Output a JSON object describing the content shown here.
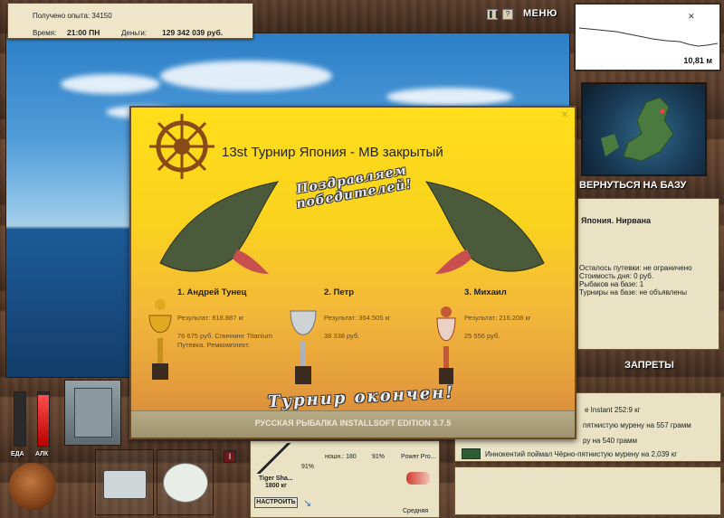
{
  "hud": {
    "experience_label": "Получено опыта:",
    "experience_value": "34150",
    "time_label": "Время:",
    "time_value": "21:00 ПН",
    "money_label": "Деньги:",
    "money_value": "129 342 039 руб.",
    "menu_label": "МЕНЮ",
    "pause_icon": "pause-icon",
    "help_icon": "help-icon"
  },
  "depth_panel": {
    "depth_value": "10,81 м"
  },
  "location": {
    "return_button": "ВЕРНУТЬСЯ НА БАЗУ",
    "name": "Япония. Нирвана",
    "info_lines": [
      "Осталось путевки: не ограничено",
      "Стоимость дня: 0 руб.",
      "Рыбаков на базе: 1",
      "Турниры на базе: не объявлены"
    ],
    "restrictions_button": "ЗАПРЕТЫ"
  },
  "catch_feed": [
    "e Instant 252:9 кг",
    "пятнистую мурену на 557 грамм",
    "ру на 540 грамм",
    "Иннокентий поймал Чёрно-пятнистую мурену на 2,039 кг"
  ],
  "gauges": {
    "food_label": "ЕДА",
    "alc_label": "АЛК",
    "food_level": 0.0,
    "alc_level": 0.95
  },
  "rod_panel": {
    "rod_name": "Tiger Sha...",
    "rod_weight": "1800 кг",
    "rod_load": "91%",
    "reel_name": "ношн.: 180",
    "line_load": "91%",
    "bait_name": "Power Pro...",
    "lure_name": "Средняя",
    "setup_button": "НАСТРОИТЬ",
    "small_button": "I"
  },
  "tournament": {
    "title": "13st Турнир Япония - MB закрытый",
    "congrats_banner": "Поздравляем победителей!",
    "finished_banner": "Турнир окончен!",
    "footer": "РУССКАЯ РЫБАЛКА INSTALLSOFT EDITION 3.7.5",
    "close_icon": "close-icon",
    "winners": [
      {
        "place": "1. Андрей Тунец",
        "result": "Результат: 818.887 кг",
        "prize": "76 675 руб. Спиннинг Titanium Путевка. Ремкомплект."
      },
      {
        "place": "2. Петр",
        "result": "Результат: 364.505 кг",
        "prize": "38 338 руб."
      },
      {
        "place": "3. Михаил",
        "result": "Результат: 216.208 кг",
        "prize": "25 556 руб."
      }
    ]
  }
}
